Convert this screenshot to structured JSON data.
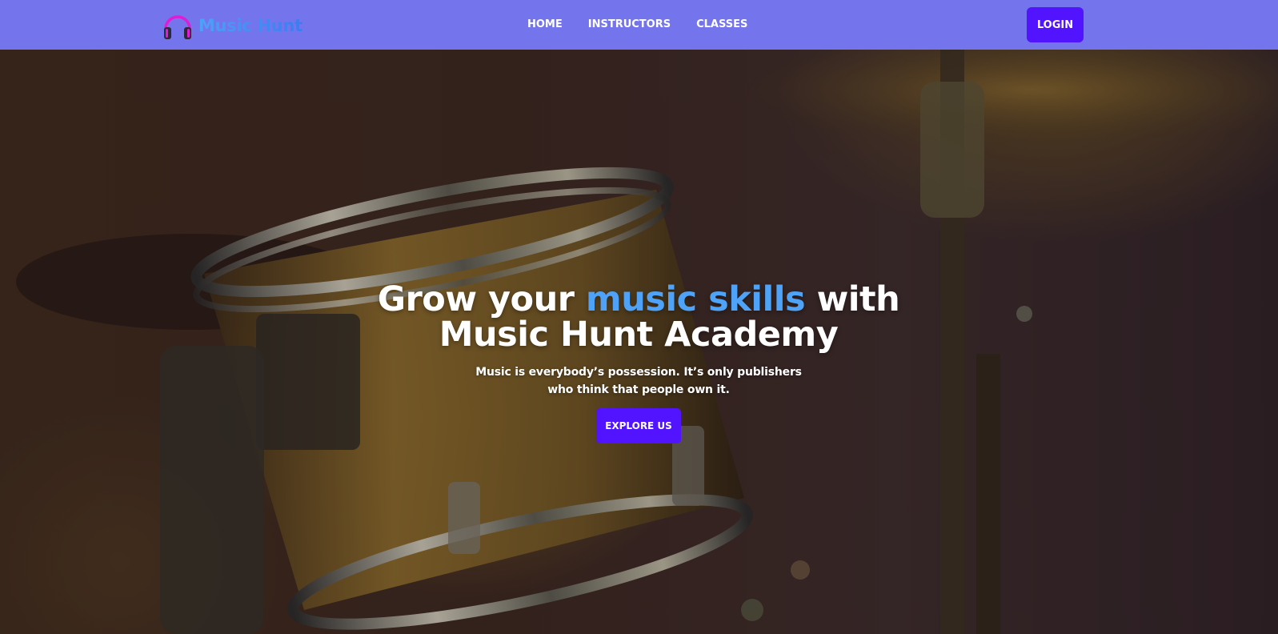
{
  "brand": {
    "name": "Music Hunt",
    "logo_icon": "headphones-icon",
    "colors": {
      "gradient_start": "#4ea2f7",
      "gradient_end": "#3b7cf2",
      "headphone": "#e11bd8"
    }
  },
  "nav": {
    "items": [
      {
        "label": "HOME"
      },
      {
        "label": "INSTRUCTORS"
      },
      {
        "label": "CLASSES"
      }
    ],
    "login_label": "LOGIN",
    "background": "#7475ec"
  },
  "hero": {
    "title_part1": "Grow your ",
    "title_accent": "music skills",
    "title_part2": " with",
    "title_line2": "Music Hunt Academy",
    "subtitle_line1": "Music is everybody’s possession. It’s only publishers",
    "subtitle_line2": "who think that people own it.",
    "cta_label": "EXPLORE US",
    "accent_color": "#4ea2f7",
    "button_color": "#5213ff"
  }
}
